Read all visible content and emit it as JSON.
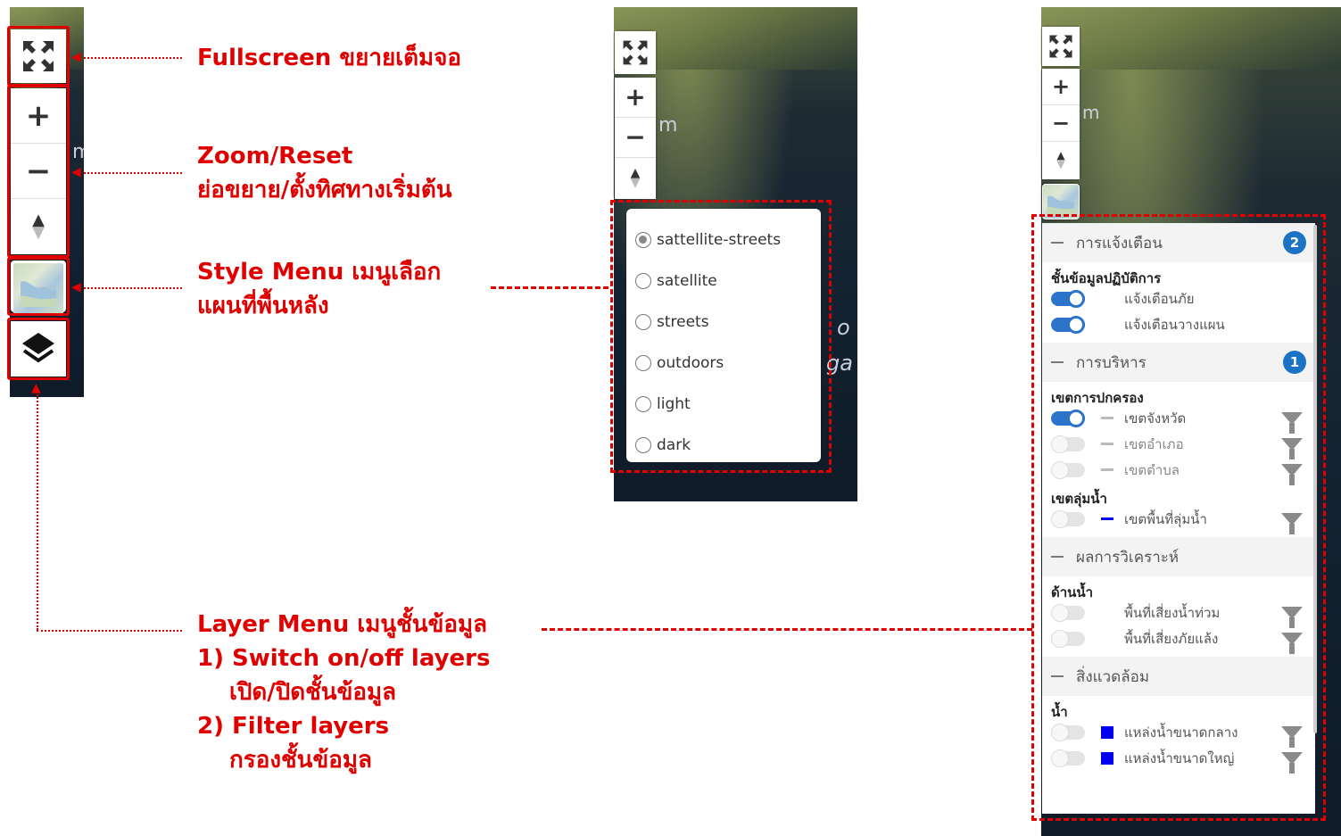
{
  "annotations": {
    "fullscreen": "Fullscreen ขยายเต็มจอ",
    "zoom_line1": "Zoom/Reset",
    "zoom_line2": "ย่อขยาย/ตั้งทิศทางเริ่มต้น",
    "style_line1": "Style Menu เมนูเลือก",
    "style_line2": "แผนที่พื้นหลัง",
    "layer_line1": "Layer Menu เมนูชั้นข้อมูล",
    "layer_line2": "1) Switch on/off layers",
    "layer_line3": "เปิด/ปิดชั้นข้อมูล",
    "layer_line4": "2) Filter layers",
    "layer_line5": "กรองชั้นข้อมูล"
  },
  "controls": {
    "fullscreen_icon": "fullscreen-icon",
    "zoom_in": "+",
    "zoom_out": "−",
    "compass_icon": "compass-icon",
    "layers_icon": "layers-icon"
  },
  "map_labels": {
    "label_m": "m",
    "label_o": "o",
    "label_ga": "ga"
  },
  "style_menu": {
    "options": [
      {
        "label": "sattellite-streets",
        "checked": true
      },
      {
        "label": "satellite",
        "checked": false
      },
      {
        "label": "streets",
        "checked": false
      },
      {
        "label": "outdoors",
        "checked": false
      },
      {
        "label": "light",
        "checked": false
      },
      {
        "label": "dark",
        "checked": false
      }
    ]
  },
  "layer_panel": {
    "sections": [
      {
        "title": "การแจ้งเตือน",
        "badge": "2",
        "groups": [
          {
            "title": "ชั้นข้อมูลปฏิบัติการ",
            "rows": [
              {
                "label": "แจ้งเตือนภัย",
                "on": true,
                "legend": "none",
                "filter": false
              },
              {
                "label": "แจ้งเตือนวางแผน",
                "on": true,
                "legend": "none",
                "filter": false
              }
            ]
          }
        ]
      },
      {
        "title": "การบริหาร",
        "badge": "1",
        "groups": [
          {
            "title": "เขตการปกครอง",
            "rows": [
              {
                "label": "เขตจังหวัด",
                "on": true,
                "legend": "line-grey",
                "filter": true
              },
              {
                "label": "เขตอำเภอ",
                "on": false,
                "legend": "line-grey",
                "filter": true
              },
              {
                "label": "เขตตำบล",
                "on": false,
                "legend": "line-grey",
                "filter": true
              }
            ]
          },
          {
            "title": "เขตลุ่มน้ำ",
            "rows": [
              {
                "label": "เขตพื้นที่ลุ่มน้ำ",
                "on": false,
                "legend": "line-blue",
                "filter": true
              }
            ]
          }
        ]
      },
      {
        "title": "ผลการวิเคราะห์",
        "badge": "",
        "groups": [
          {
            "title": "ด้านน้ำ",
            "rows": [
              {
                "label": "พื้นที่เสี่ยงน้ำท่วม",
                "on": false,
                "legend": "none",
                "filter": true
              },
              {
                "label": "พื้นที่เสี่ยงภัยแล้ง",
                "on": false,
                "legend": "none",
                "filter": true
              }
            ]
          }
        ]
      },
      {
        "title": "สิ่งแวดล้อม",
        "badge": "",
        "groups": [
          {
            "title": "น้ำ",
            "rows": [
              {
                "label": "แหล่งน้ำขนาดกลาง",
                "on": false,
                "legend": "box-blue",
                "filter": true
              },
              {
                "label": "แหล่งน้ำขนาดใหญ่",
                "on": false,
                "legend": "box-blue",
                "filter": true
              }
            ]
          }
        ]
      }
    ]
  },
  "colors": {
    "annotation_red": "#e00000",
    "toggle_on": "#2b74c9",
    "badge": "#1a73c4",
    "legend_blue": "#0000ee",
    "legend_grey": "#bbbbbb"
  }
}
